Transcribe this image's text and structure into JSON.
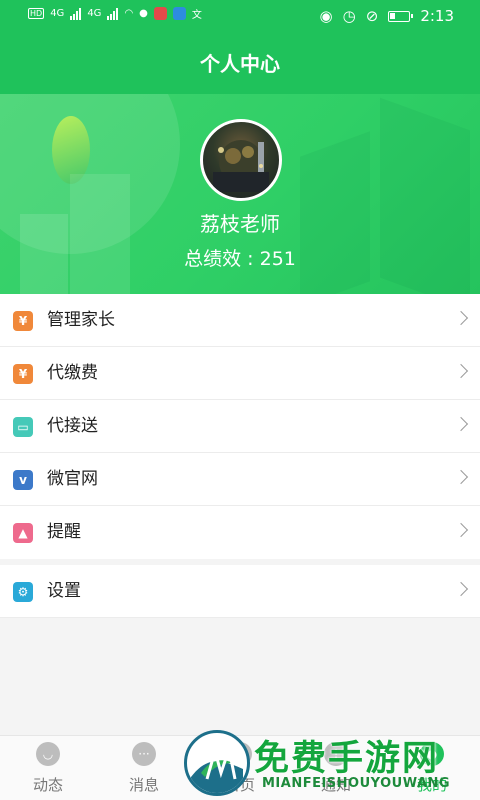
{
  "status_bar": {
    "network_1": "4G",
    "network_2": "4G",
    "time": "2:13"
  },
  "header": {
    "title": "个人中心"
  },
  "profile": {
    "name": "荔枝老师",
    "score_text": "总绩效 : 251"
  },
  "menu": {
    "items": [
      {
        "label": "管理家长",
        "icon": "money-bag-icon",
        "color": "#f0883a"
      },
      {
        "label": "代缴费",
        "icon": "money-bag-icon",
        "color": "#f0883a"
      },
      {
        "label": "代接送",
        "icon": "bus-icon",
        "color": "#45c9b8"
      },
      {
        "label": "微官网",
        "icon": "vimeo-v-icon",
        "color": "#3c79c9"
      },
      {
        "label": "提醒",
        "icon": "bell-icon",
        "color": "#ee6a8d"
      },
      {
        "label": "设置",
        "icon": "gear-icon",
        "color": "#2aa9d8"
      }
    ]
  },
  "tabbar": {
    "tabs": [
      {
        "label": "动态",
        "icon": "people-icon"
      },
      {
        "label": "消息",
        "icon": "chat-icon"
      },
      {
        "label": "首页",
        "icon": "home-icon"
      },
      {
        "label": "通知",
        "icon": "notice-icon"
      },
      {
        "label": "我的",
        "icon": "user-icon"
      }
    ]
  },
  "watermark": {
    "text": "免费手游网",
    "subtext": "MIANFEISHOUYOUWANG"
  },
  "colors": {
    "brand_green": "#1fc25b",
    "text_dark": "#222222",
    "chevron": "#9a9a9a"
  }
}
